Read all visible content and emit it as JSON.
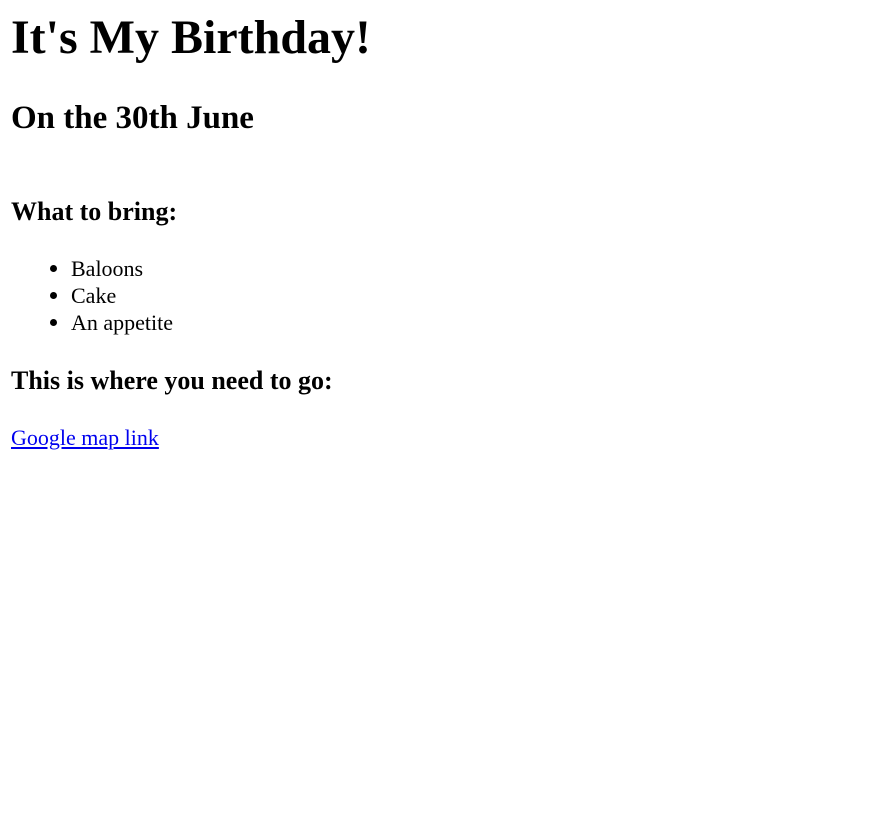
{
  "page": {
    "title": "It's My Birthday!",
    "subtitle": "On the 30th June",
    "bring_heading": "What to bring:",
    "bring_items": [
      {
        "label": "Baloons"
      },
      {
        "label": "Cake"
      },
      {
        "label": "An appetite"
      }
    ],
    "directions_heading": "This is where you need to go:",
    "map_link": {
      "label": "Google map link",
      "color": "#0000ee"
    }
  }
}
